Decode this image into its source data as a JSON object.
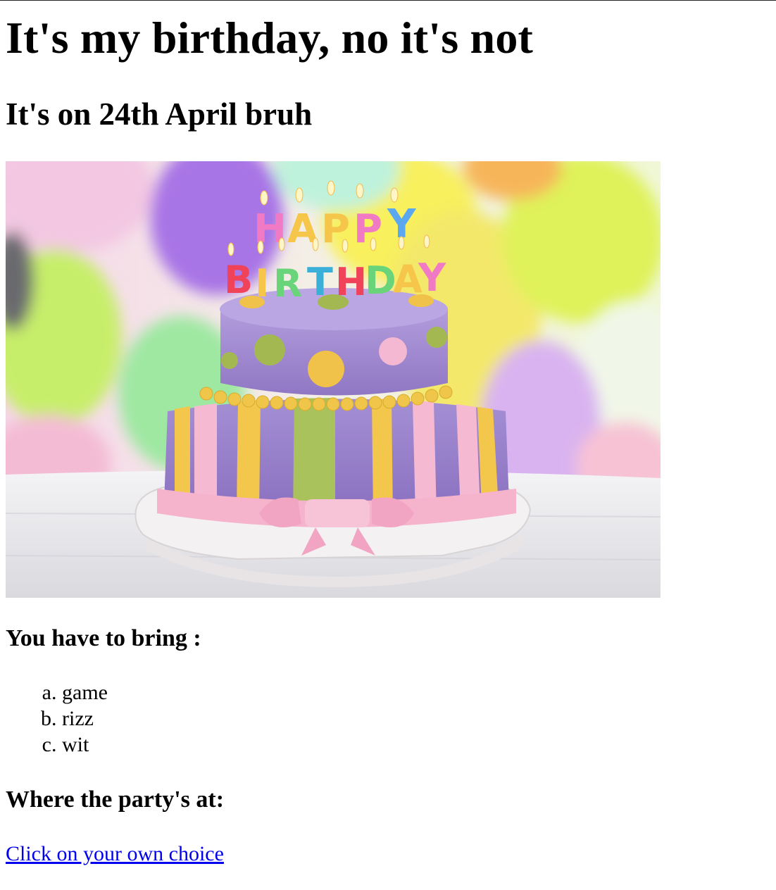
{
  "page": {
    "title": "It's my birthday, no it's not",
    "subtitle": "It's on 24th April bruh"
  },
  "hero_image": {
    "alt": "HAPPY BIRTHDAY",
    "candle_letters_top": [
      "H",
      "A",
      "P",
      "P",
      "Y"
    ],
    "candle_letters_bottom": [
      "B",
      "I",
      "R",
      "T",
      "H",
      "D",
      "A",
      "Y"
    ],
    "colors": {
      "cake_purple": "#a48fd4",
      "cake_pink": "#f5b9d1",
      "cake_yellow": "#f3c64c",
      "cake_green": "#a9c25b",
      "board": "#f3f1f2"
    }
  },
  "bring_section": {
    "heading": "You have to bring :",
    "items": [
      "game",
      "rizz",
      "wit"
    ]
  },
  "location_section": {
    "heading": "Where the party's at:",
    "link_text": "Click on your own choice"
  }
}
